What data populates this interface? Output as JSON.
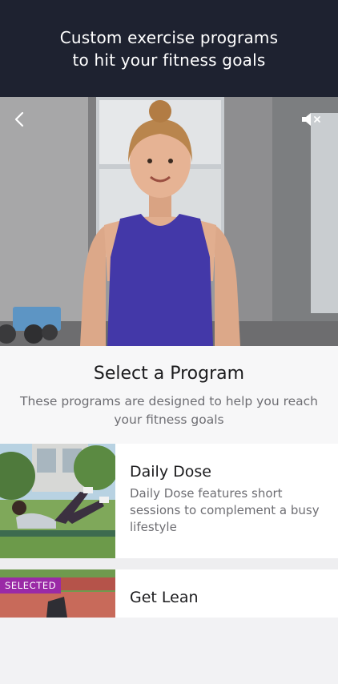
{
  "header": {
    "line1": "Custom exercise programs",
    "line2": "to hit your fitness goals"
  },
  "video": {
    "back_icon": "chevron-left-icon",
    "mute_icon": "speaker-muted-icon"
  },
  "select": {
    "title": "Select a Program",
    "subtitle_line1": "These programs are designed to help you reach",
    "subtitle_line2": "your fitness goals"
  },
  "programs": [
    {
      "title": "Daily Dose",
      "description_line1": "Daily Dose features short",
      "description_line2": "sessions to complement a busy",
      "description_line3": "lifestyle"
    },
    {
      "title": "Get Lean",
      "badge": "SELECTED"
    }
  ],
  "colors": {
    "header_bg": "#1e2230",
    "badge_bg": "#9a2aa6"
  }
}
